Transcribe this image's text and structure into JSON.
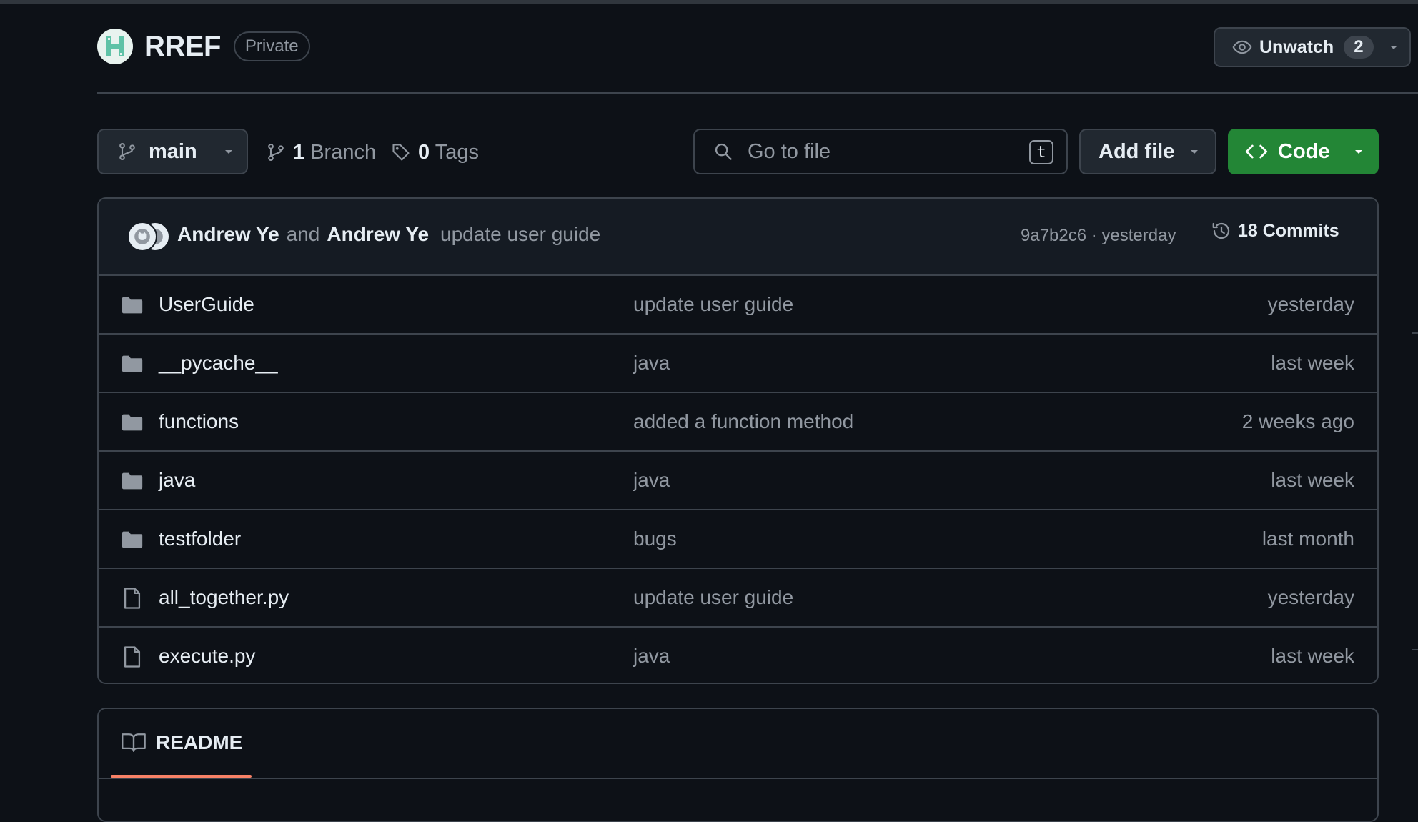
{
  "header": {
    "repo_name": "RREF",
    "visibility": "Private",
    "unwatch_label": "Unwatch",
    "unwatch_count": "2"
  },
  "toolbar": {
    "branch": "main",
    "branch_count": "1",
    "branch_label": "Branch",
    "tag_count": "0",
    "tag_label": "Tags",
    "search_placeholder": "Go to file",
    "search_shortcut": "t",
    "add_file_label": "Add file",
    "code_label": "Code"
  },
  "commit": {
    "author1": "Andrew Ye",
    "conjunction": "and",
    "author2": "Andrew Ye",
    "message": "update user guide",
    "meta": "9a7b2c6 · yesterday",
    "commits_label": "18 Commits"
  },
  "files": [
    {
      "type": "folder",
      "name": "UserGuide",
      "message": "update user guide",
      "time": "yesterday"
    },
    {
      "type": "folder",
      "name": "__pycache__",
      "message": "java",
      "time": "last week"
    },
    {
      "type": "folder",
      "name": "functions",
      "message": "added a function method",
      "time": "2 weeks ago"
    },
    {
      "type": "folder",
      "name": "java",
      "message": "java",
      "time": "last week"
    },
    {
      "type": "folder",
      "name": "testfolder",
      "message": "bugs",
      "time": "last month"
    },
    {
      "type": "file",
      "name": "all_together.py",
      "message": "update user guide",
      "time": "yesterday"
    },
    {
      "type": "file",
      "name": "execute.py",
      "message": "java",
      "time": "last week"
    }
  ],
  "readme": {
    "tab_label": "README"
  },
  "colors": {
    "background": "#0d1117",
    "border": "#3d444d",
    "code_button": "#238636",
    "readme_underline": "#f78166",
    "muted_text": "#9198a1"
  },
  "icons": {
    "folder": "folder-icon",
    "file": "file-icon"
  }
}
